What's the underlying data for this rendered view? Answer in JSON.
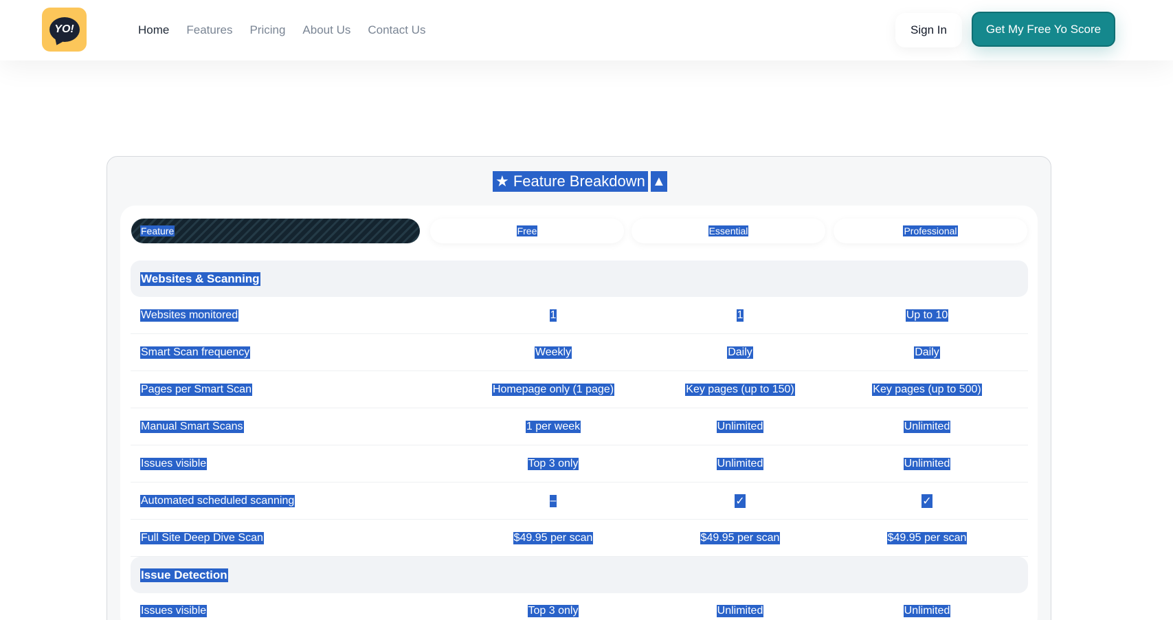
{
  "header": {
    "logo_text": "YO!",
    "nav": [
      "Home",
      "Features",
      "Pricing",
      "About Us",
      "Contact Us"
    ],
    "sign_in": "Sign In",
    "cta": "Get My Free Yo Score"
  },
  "colors": {
    "accent": "#15888d",
    "logo_bg": "#fcc65a",
    "selection": "#2962c9"
  },
  "table": {
    "title_star": "★",
    "title": "Feature Breakdown",
    "toggle_icon": "triangle-up-icon",
    "columns": [
      "Feature",
      "Free",
      "Essential",
      "Professional"
    ],
    "sections": [
      {
        "name": "Websites & Scanning",
        "rows": [
          [
            "Websites monitored",
            "1",
            "1",
            "Up to 10"
          ],
          [
            "Smart Scan frequency",
            "Weekly",
            "Daily",
            "Daily"
          ],
          [
            "Pages per Smart Scan",
            "Homepage only (1 page)",
            "Key pages (up to 150)",
            "Key pages (up to 500)"
          ],
          [
            "Manual Smart Scans",
            "1 per week",
            "Unlimited",
            "Unlimited"
          ],
          [
            "Issues visible",
            "Top 3 only",
            "Unlimited",
            "Unlimited"
          ],
          [
            "Automated scheduled scanning",
            "–",
            "✓",
            "✓"
          ],
          [
            "Full Site Deep Dive Scan",
            "$49.95 per scan",
            "$49.95 per scan",
            "$49.95 per scan"
          ]
        ]
      },
      {
        "name": "Issue Detection",
        "rows": [
          [
            "Issues visible",
            "Top 3 only",
            "Unlimited",
            "Unlimited"
          ]
        ]
      }
    ]
  }
}
